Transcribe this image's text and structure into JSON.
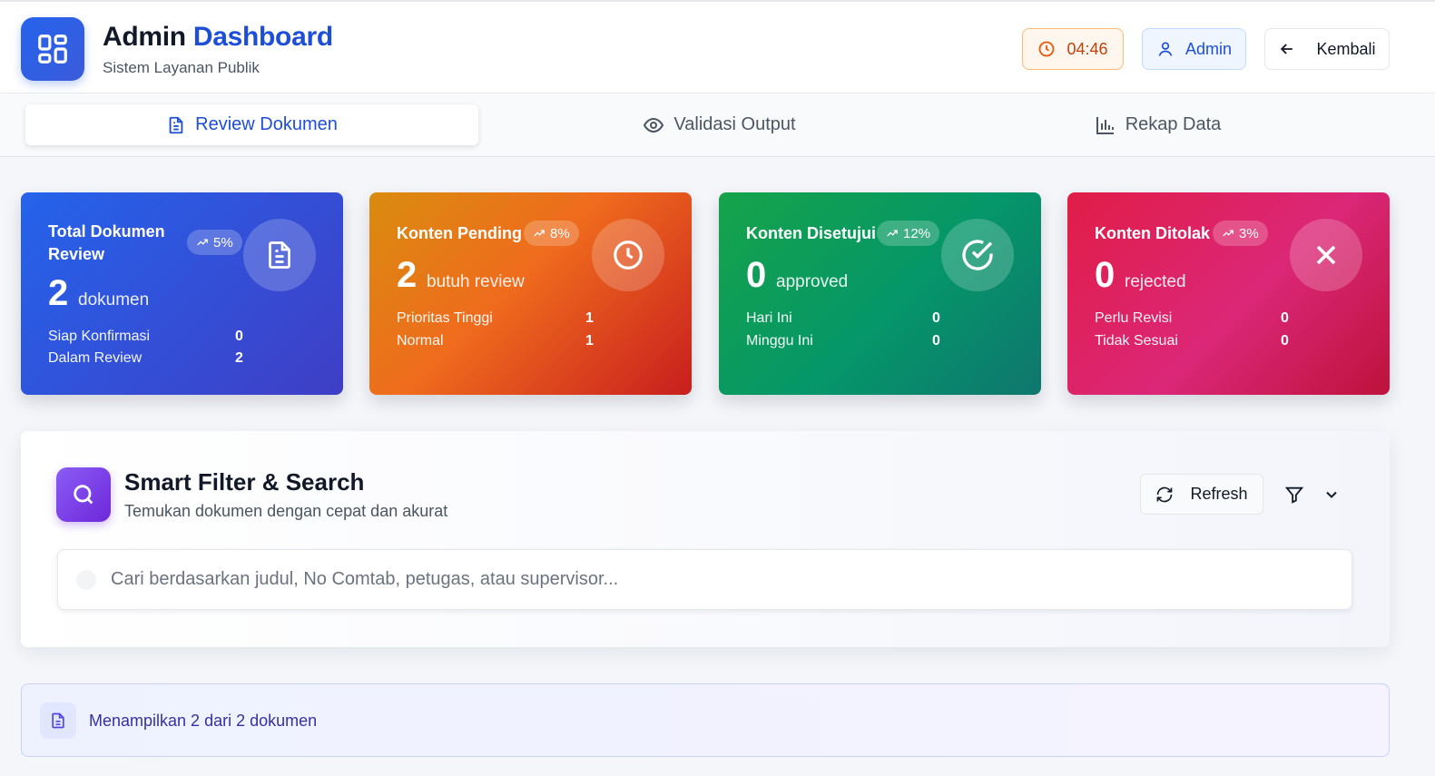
{
  "header": {
    "title_main": "Admin",
    "title_accent": "Dashboard",
    "subtitle": "Sistem Layanan Publik",
    "time": "04:46",
    "user_label": "Admin",
    "back_label": "Kembali",
    "logo_icon": "grid-icon"
  },
  "tabs": [
    {
      "label": "Review Dokumen",
      "icon": "document-icon",
      "active": true
    },
    {
      "label": "Validasi Output",
      "icon": "eye-icon",
      "active": false
    },
    {
      "label": "Rekap Data",
      "icon": "bar-chart-icon",
      "active": false
    }
  ],
  "cards": [
    {
      "label_line1": "Total Dokumen",
      "label_line2": "Review",
      "trend": "5%",
      "value": "2",
      "unit": "dokumen",
      "icon": "document-icon",
      "rows": [
        {
          "label": "Siap Konfirmasi",
          "value": "0"
        },
        {
          "label": "Dalam Review",
          "value": "2"
        }
      ]
    },
    {
      "label": "Konten Pending",
      "trend": "8%",
      "value": "2",
      "unit": "butuh review",
      "icon": "clock-icon",
      "rows": [
        {
          "label": "Prioritas Tinggi",
          "value": "1"
        },
        {
          "label": "Normal",
          "value": "1"
        }
      ]
    },
    {
      "label": "Konten Disetujui",
      "trend": "12%",
      "value": "0",
      "unit": "approved",
      "icon": "check-circle-icon",
      "rows": [
        {
          "label": "Hari Ini",
          "value": "0"
        },
        {
          "label": "Minggu Ini",
          "value": "0"
        }
      ]
    },
    {
      "label": "Konten Ditolak",
      "trend": "3%",
      "value": "0",
      "unit": "rejected",
      "icon": "close-icon",
      "rows": [
        {
          "label": "Perlu Revisi",
          "value": "0"
        },
        {
          "label": "Tidak Sesuai",
          "value": "0"
        }
      ]
    }
  ],
  "filter": {
    "title": "Smart Filter & Search",
    "subtitle": "Temukan dokumen dengan cepat dan akurat",
    "refresh_label": "Refresh",
    "search_placeholder": "Cari berdasarkan judul, No Comtab, petugas, atau supervisor...",
    "search_value": ""
  },
  "results": {
    "text": "Menampilkan 2 dari 2 dokumen"
  },
  "colors": {
    "primary": "#1d4ed8",
    "card_blue": "#2563eb",
    "card_orange": "#ef6b1d",
    "card_green": "#059669",
    "card_red": "#e11d48",
    "filter_accent": "#7c3aed"
  }
}
